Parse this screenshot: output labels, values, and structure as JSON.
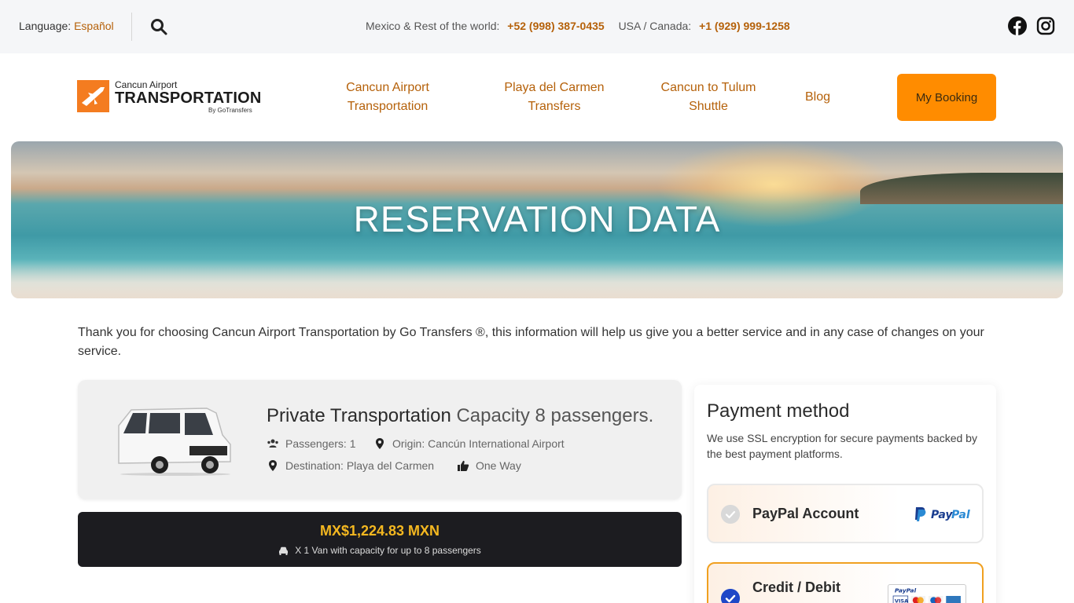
{
  "topbar": {
    "language_label": "Language:",
    "language_value": "Español",
    "phones": [
      {
        "region": "Mexico & Rest of the world:",
        "number": "+52 (998) 387-0435"
      },
      {
        "region": "USA / Canada:",
        "number": "+1 (929) 999-1258"
      }
    ],
    "social": [
      "facebook-icon",
      "instagram-icon"
    ]
  },
  "logo": {
    "line1": "Cancun Airport",
    "line2": "TRANSPORTATION",
    "line3": "By GoTransfers"
  },
  "nav": {
    "items": [
      {
        "label_1": "Cancun Airport",
        "label_2": "Transportation"
      },
      {
        "label_1": "Playa del Carmen",
        "label_2": "Transfers"
      },
      {
        "label_1": "Cancun to Tulum",
        "label_2": "Shuttle"
      },
      {
        "label_1": "Blog"
      }
    ],
    "cta": "My Booking"
  },
  "hero": {
    "title": "RESERVATION DATA"
  },
  "intro": "Thank you for choosing Cancun Airport Transportation by Go Transfers ®, this information will help us give you a better service and in any case of changes on your service.",
  "service": {
    "title": "Private Transportation",
    "capacity": "Capacity 8 passengers.",
    "passengers": "Passengers: 1",
    "origin": "Origin: Cancún International Airport",
    "destination": "Destination: Playa del Carmen",
    "trip_type": "One Way"
  },
  "price": {
    "amount": "MX$1,224.83 MXN",
    "detail": "X 1 Van with capacity for up to 8 passengers"
  },
  "payment": {
    "title": "Payment method",
    "note": "We use SSL encryption for secure payments backed by the best payment platforms.",
    "options": [
      {
        "label": "PayPal Account",
        "selected": false
      },
      {
        "label": "Credit / Debit",
        "selected": true
      }
    ]
  },
  "colors": {
    "accent": "#ff8c00",
    "link": "#b5610a",
    "price": "#f5b820",
    "selected": "#1f47c7"
  }
}
